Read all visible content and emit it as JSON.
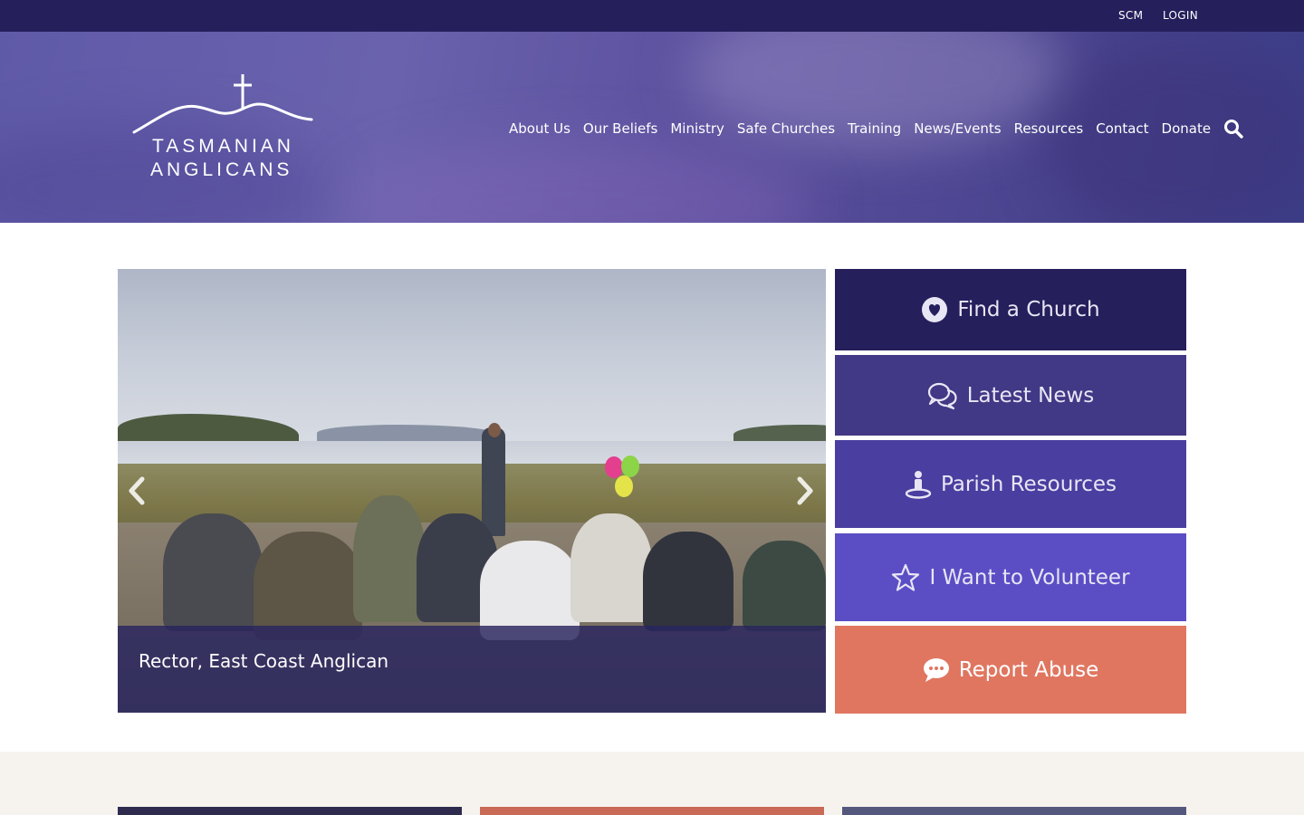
{
  "topbar": {
    "links": [
      {
        "label": "SCM"
      },
      {
        "label": "LOGIN"
      }
    ]
  },
  "logo": {
    "line1": "TASMANIAN",
    "line2": "ANGLICANS"
  },
  "nav": {
    "items": [
      {
        "label": "About Us"
      },
      {
        "label": "Our Beliefs"
      },
      {
        "label": "Ministry"
      },
      {
        "label": "Safe Churches"
      },
      {
        "label": "Training"
      },
      {
        "label": "News/Events"
      },
      {
        "label": "Resources"
      },
      {
        "label": "Contact"
      },
      {
        "label": "Donate"
      }
    ],
    "search_icon": "search-icon"
  },
  "slider": {
    "caption": "Rector, East Coast Anglican",
    "prev_icon": "chevron-left-icon",
    "next_icon": "chevron-right-icon"
  },
  "quick_links": [
    {
      "label": "Find a Church",
      "icon": "heart-circle-icon",
      "color": "#251f5c"
    },
    {
      "label": "Latest News",
      "icon": "chat-bubbles-icon",
      "color": "#413886"
    },
    {
      "label": "Parish Resources",
      "icon": "person-icon",
      "color": "#4a3ea0"
    },
    {
      "label": "I Want to Volunteer",
      "icon": "star-icon",
      "color": "#5b4ec5"
    },
    {
      "label": "Report Abuse",
      "icon": "speech-bubble-icon",
      "color": "#e07660"
    }
  ],
  "colors": {
    "topbar": "#251f5c",
    "band": "#f6f3ee"
  }
}
